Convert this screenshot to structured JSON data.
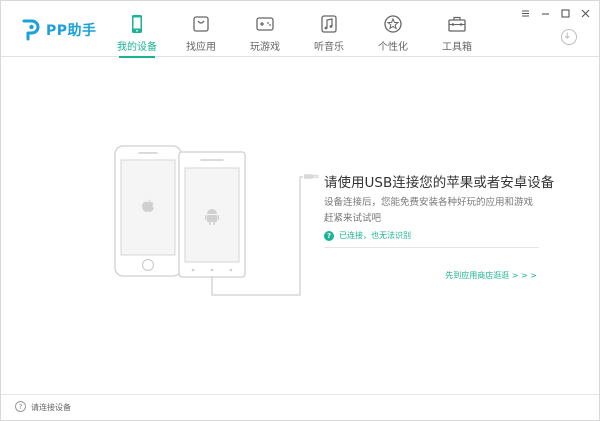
{
  "app": {
    "title": "PP助手"
  },
  "nav": {
    "items": [
      {
        "label": "我的设备",
        "icon": "phone-icon",
        "active": true
      },
      {
        "label": "找应用",
        "icon": "app-bag-icon",
        "active": false
      },
      {
        "label": "玩游戏",
        "icon": "gamepad-icon",
        "active": false
      },
      {
        "label": "听音乐",
        "icon": "music-icon",
        "active": false
      },
      {
        "label": "个性化",
        "icon": "star-icon",
        "active": false
      },
      {
        "label": "工具箱",
        "icon": "toolbox-icon",
        "active": false
      }
    ]
  },
  "window_controls": [
    "settings-icon",
    "minimize-icon",
    "maximize-icon",
    "close-icon"
  ],
  "main": {
    "tagline": "请使用USB连接您的苹果或者安卓设备",
    "description_line1": "设备连接后，您能免费安装各种好玩的应用和游戏",
    "description_line2": "赶紧来试试吧",
    "help_link": "已连接，也无法识别",
    "store_link": "先到应用商店逛逛 > > >"
  },
  "status": {
    "text": "请连接设备"
  },
  "colors": {
    "accent": "#1ab394",
    "logo": "#1aa1d8",
    "line_art": "#cfcfcf"
  }
}
